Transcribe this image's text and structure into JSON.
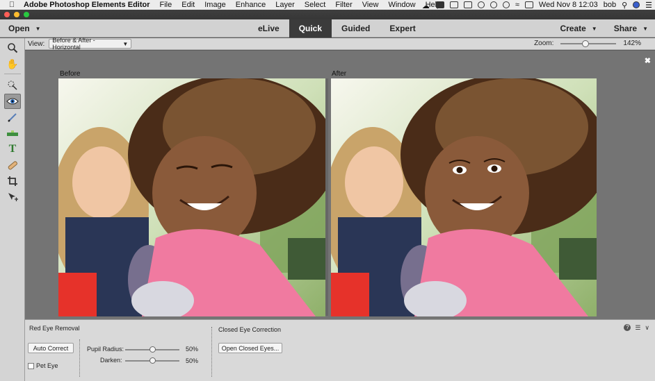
{
  "menubar": {
    "app_name": "Adobe Photoshop Elements Editor",
    "menus": [
      "File",
      "Edit",
      "Image",
      "Enhance",
      "Layer",
      "Select",
      "Filter",
      "View",
      "Window",
      "Help"
    ],
    "clock": "Wed Nov 8  12:03",
    "user": "bob"
  },
  "toolbar": {
    "open_label": "Open",
    "modes": [
      "eLive",
      "Quick",
      "Guided",
      "Expert"
    ],
    "active_mode": "Quick",
    "create_label": "Create",
    "share_label": "Share"
  },
  "options": {
    "view_label": "View:",
    "view_value": "Before & After - Horizontal",
    "zoom_label": "Zoom:",
    "zoom_value": "142%",
    "zoom_fraction": 0.45
  },
  "canvas": {
    "before_label": "Before",
    "after_label": "After"
  },
  "tools": [
    {
      "name": "zoom-tool",
      "icon": "magnifier-icon"
    },
    {
      "name": "hand-tool",
      "icon": "hand-icon"
    },
    {
      "name": "quick-selection-tool",
      "icon": "quick-selection-icon"
    },
    {
      "name": "red-eye-removal-tool",
      "icon": "eye-icon",
      "active": true
    },
    {
      "name": "whiten-teeth-tool",
      "icon": "brush-icon"
    },
    {
      "name": "straighten-tool",
      "icon": "level-icon"
    },
    {
      "name": "type-tool",
      "icon": "type-icon"
    },
    {
      "name": "spot-healing-tool",
      "icon": "bandage-icon"
    },
    {
      "name": "crop-tool",
      "icon": "crop-icon"
    },
    {
      "name": "move-tool",
      "icon": "move-icon"
    }
  ],
  "bottom": {
    "red_eye_title": "Red Eye Removal",
    "auto_correct_label": "Auto Correct",
    "pet_eye_label": "Pet Eye",
    "pupil_radius_label": "Pupil Radius:",
    "pupil_radius_value": "50%",
    "darken_label": "Darken:",
    "darken_value": "50%",
    "closed_eye_title": "Closed Eye Correction",
    "open_closed_eyes_label": "Open Closed Eyes..."
  }
}
